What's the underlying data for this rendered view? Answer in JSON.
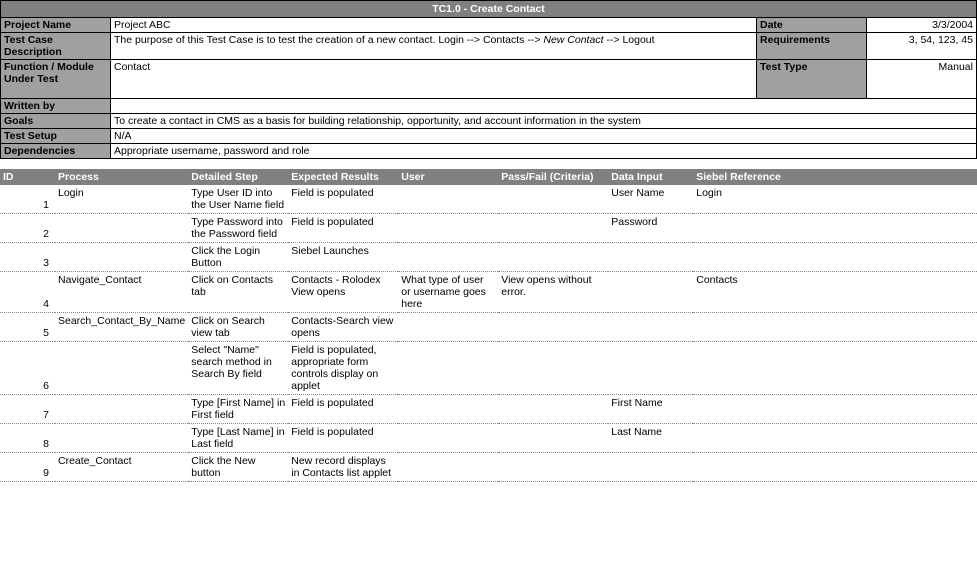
{
  "header": {
    "title": "TC1.0 - Create Contact",
    "labels": {
      "project_name": "Project Name",
      "date": "Date",
      "desc": "Test Case Description",
      "requirements": "Requirements",
      "func": "Function / Module Under Test",
      "test_type": "Test Type",
      "written_by": "Written by",
      "goals": "Goals",
      "test_setup": "Test Setup",
      "deps": "Dependencies"
    },
    "values": {
      "project_name": "Project ABC",
      "date": "3/3/2004",
      "desc_part1": "The purpose of this Test Case is to test the creation of a new contact.  Login --> Contacts --> ",
      "desc_italic": "New Contact",
      "desc_part2": " --> Logout",
      "requirements": "3, 54, 123, 45",
      "func": "Contact",
      "test_type": "Manual",
      "written_by": "",
      "goals": "To create a contact in CMS as a basis for building relationship, opportunity, and account information in the system",
      "test_setup": "N/A",
      "deps": "Appropriate username, password and role"
    }
  },
  "columns": {
    "id": "ID",
    "process": "Process",
    "step": "Detailed Step",
    "expected": "Expected Results",
    "user": "User",
    "passfail": "Pass/Fail (Criteria)",
    "input": "Data Input",
    "siebel": "Siebel Reference"
  },
  "rows": [
    {
      "id": "1",
      "process": "Login",
      "step": "Type User ID into the User Name field",
      "expected": "Field is populated",
      "user": "",
      "passfail": "",
      "input": "User Name",
      "siebel": "Login"
    },
    {
      "id": "2",
      "process": "",
      "step": "Type Password into the Password field",
      "expected": "Field is populated",
      "user": "",
      "passfail": "",
      "input": "Password",
      "siebel": ""
    },
    {
      "id": "3",
      "process": "",
      "step": "Click the Login Button",
      "expected": "Siebel Launches",
      "user": "",
      "passfail": "",
      "input": "",
      "siebel": ""
    },
    {
      "id": "4",
      "process": "Navigate_Contact",
      "step": "Click on Contacts tab",
      "expected": "Contacts - Rolodex View opens",
      "user": "What type of user or username goes here",
      "passfail": "View opens without error.",
      "input": "",
      "siebel": "Contacts"
    },
    {
      "id": "5",
      "process": "Search_Contact_By_Name",
      "step": "Click on Search view tab",
      "expected": "Contacts-Search view opens",
      "user": "",
      "passfail": "",
      "input": "",
      "siebel": ""
    },
    {
      "id": "6",
      "process": "",
      "step": "Select \"Name\" search method in Search By field",
      "expected": "Field is populated, appropriate form controls display on applet",
      "user": "",
      "passfail": "",
      "input": "",
      "siebel": ""
    },
    {
      "id": "7",
      "process": "",
      "step": "Type [First Name] in First field",
      "expected": "Field is populated",
      "user": "",
      "passfail": "",
      "input": "First Name",
      "siebel": ""
    },
    {
      "id": "8",
      "process": "",
      "step": "Type [Last Name] in Last field",
      "expected": "Field is populated",
      "user": "",
      "passfail": "",
      "input": "Last Name",
      "siebel": ""
    },
    {
      "id": "9",
      "process": "Create_Contact",
      "step": "Click the New button",
      "expected": "New record displays in Contacts list applet",
      "user": "",
      "passfail": "",
      "input": "",
      "siebel": ""
    }
  ]
}
